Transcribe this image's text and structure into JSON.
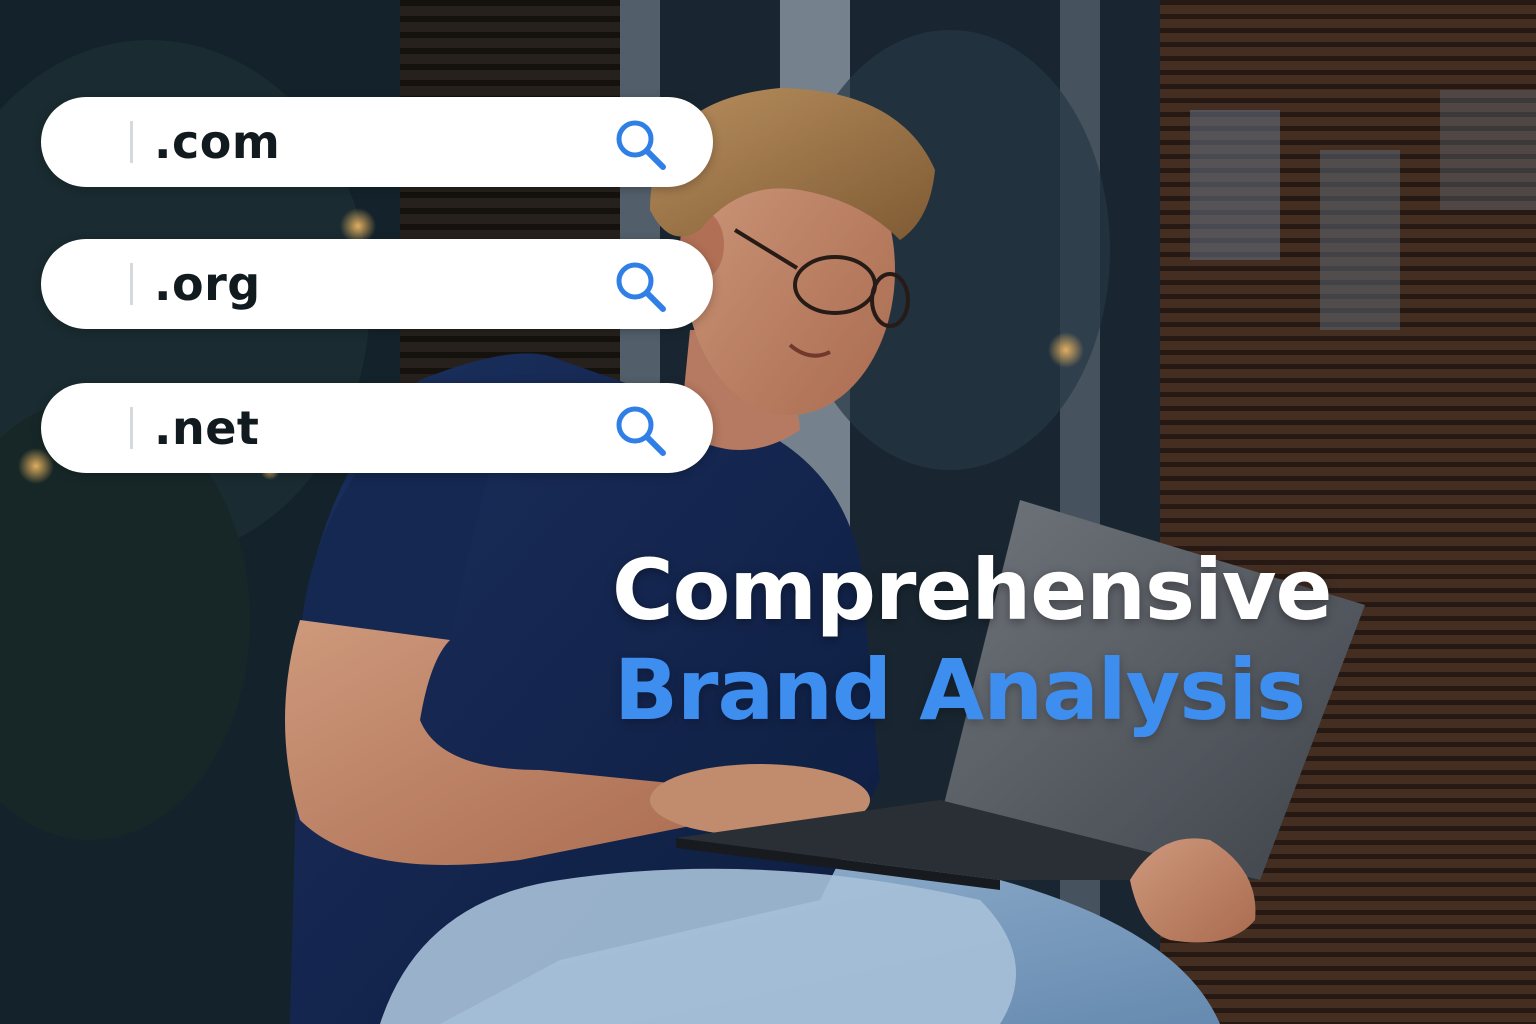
{
  "search_bars": [
    {
      "text": ".com",
      "icon": "search-icon"
    },
    {
      "text": ".org",
      "icon": "search-icon"
    },
    {
      "text": ".net",
      "icon": "search-icon"
    }
  ],
  "headline": {
    "line1": "Comprehensive",
    "line2": "Brand Analysis"
  },
  "colors": {
    "accent": "#3e8ef0",
    "headline_white": "#ffffff",
    "search_icon": "#2f7fe6",
    "search_text": "#111a1f"
  }
}
